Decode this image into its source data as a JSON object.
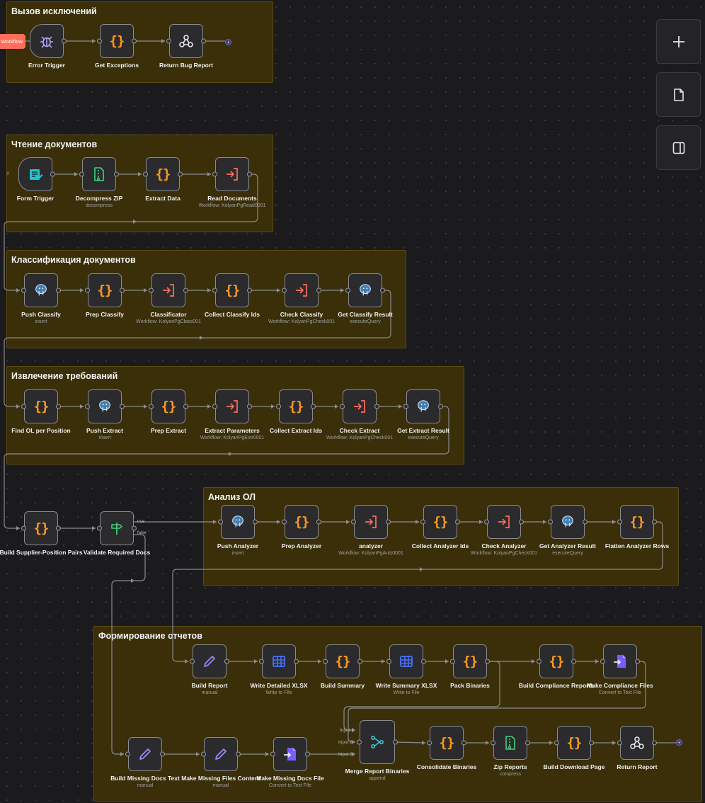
{
  "workflow_badge": "Workflow",
  "side_buttons": [
    {
      "name": "add-node-button",
      "icon": "plus-icon"
    },
    {
      "name": "sticky-note-button",
      "icon": "note-icon"
    },
    {
      "name": "toggle-panel-button",
      "icon": "panel-icon"
    }
  ],
  "groups": [
    {
      "id": "g1",
      "title": "Вызов исключений"
    },
    {
      "id": "g2",
      "title": "Чтение документов"
    },
    {
      "id": "g3",
      "title": "Классификация документов"
    },
    {
      "id": "g4",
      "title": "Извлечение требований"
    },
    {
      "id": "g5",
      "title": "Анализ ОЛ"
    },
    {
      "id": "g6",
      "title": "Формирование отчетов"
    }
  ],
  "nodes": [
    {
      "id": "n1",
      "label": "Error Trigger",
      "sub": "",
      "icon": "bug-icon"
    },
    {
      "id": "n2",
      "label": "Get Exceptions",
      "sub": "",
      "icon": "code-icon"
    },
    {
      "id": "n3",
      "label": "Return Bug Report",
      "sub": "",
      "icon": "webhook-icon"
    },
    {
      "id": "n4",
      "label": "Form Trigger",
      "sub": "",
      "icon": "form-icon"
    },
    {
      "id": "n5",
      "label": "Decompress ZIP",
      "sub": "decompress",
      "icon": "zip-file-icon"
    },
    {
      "id": "n6",
      "label": "Extract Data",
      "sub": "",
      "icon": "code-icon"
    },
    {
      "id": "n7",
      "label": "Read Documents",
      "sub": "Workflow: KolyanPgRead0001",
      "icon": "execute-workflow-icon"
    },
    {
      "id": "n8",
      "label": "Push Classify",
      "sub": "insert",
      "icon": "postgres-icon"
    },
    {
      "id": "n9",
      "label": "Prep Classify",
      "sub": "",
      "icon": "code-icon"
    },
    {
      "id": "n10",
      "label": "Classificator",
      "sub": "Workflow: KolyanPgClass001",
      "icon": "execute-workflow-icon"
    },
    {
      "id": "n11",
      "label": "Collect Classify Ids",
      "sub": "",
      "icon": "code-icon"
    },
    {
      "id": "n12",
      "label": "Check Classify",
      "sub": "Workflow: KolyanPgCheck001",
      "icon": "execute-workflow-icon"
    },
    {
      "id": "n13",
      "label": "Get Classify Result",
      "sub": "executeQuery",
      "icon": "postgres-icon"
    },
    {
      "id": "n14",
      "label": "Find OL per Position",
      "sub": "",
      "icon": "code-icon"
    },
    {
      "id": "n15",
      "label": "Push Extract",
      "sub": "insert",
      "icon": "postgres-icon"
    },
    {
      "id": "n16",
      "label": "Prep Extract",
      "sub": "",
      "icon": "code-icon"
    },
    {
      "id": "n17",
      "label": "Extract Parameters",
      "sub": "Workflow: KolyanPgExtr0001",
      "icon": "execute-workflow-icon"
    },
    {
      "id": "n18",
      "label": "Collect Extract Ids",
      "sub": "",
      "icon": "code-icon"
    },
    {
      "id": "n19",
      "label": "Check Extract",
      "sub": "Workflow: KolyanPgCheck001",
      "icon": "execute-workflow-icon"
    },
    {
      "id": "n20",
      "label": "Get Extract Result",
      "sub": "executeQuery",
      "icon": "postgres-icon"
    },
    {
      "id": "n21",
      "label": "Build Supplier-Position Pairs",
      "sub": "",
      "icon": "code-icon"
    },
    {
      "id": "n22",
      "label": "Validate Required Docs",
      "sub": "",
      "icon": "if-signpost-icon"
    },
    {
      "id": "n23",
      "label": "Push Analyzer",
      "sub": "insert",
      "icon": "postgres-icon"
    },
    {
      "id": "n24",
      "label": "Prep Analyzer",
      "sub": "",
      "icon": "code-icon"
    },
    {
      "id": "n25",
      "label": "analyzer",
      "sub": "Workflow: KolyanPgAnlz0001",
      "icon": "execute-workflow-icon"
    },
    {
      "id": "n26",
      "label": "Collect Analyzer Ids",
      "sub": "",
      "icon": "code-icon"
    },
    {
      "id": "n27",
      "label": "Check Analyzer",
      "sub": "Workflow: KolyanPgCheck001",
      "icon": "execute-workflow-icon"
    },
    {
      "id": "n28",
      "label": "Get Analyzer Result",
      "sub": "executeQuery",
      "icon": "postgres-icon"
    },
    {
      "id": "n29",
      "label": "Flatten Analyzer Rows",
      "sub": "",
      "icon": "code-icon"
    },
    {
      "id": "n30",
      "label": "Build Report",
      "sub": "manual",
      "icon": "pencil-icon"
    },
    {
      "id": "n31",
      "label": "Write Detailed XLSX",
      "sub": "Write to File",
      "icon": "spreadsheet-icon"
    },
    {
      "id": "n32",
      "label": "Build Summary",
      "sub": "",
      "icon": "code-icon"
    },
    {
      "id": "n33",
      "label": "Write Summary XLSX",
      "sub": "Write to File",
      "icon": "spreadsheet-icon"
    },
    {
      "id": "n34",
      "label": "Pack Binaries",
      "sub": "",
      "icon": "code-icon"
    },
    {
      "id": "n35",
      "label": "Build Compliance Reports",
      "sub": "",
      "icon": "code-icon"
    },
    {
      "id": "n36",
      "label": "Make Compliance Files",
      "sub": "Convert to Text File",
      "icon": "convert-file-icon"
    },
    {
      "id": "n37",
      "label": "Build Missing Docs Text",
      "sub": "manual",
      "icon": "pencil-icon"
    },
    {
      "id": "n38",
      "label": "Make Missing Files Content",
      "sub": "manual",
      "icon": "pencil-icon"
    },
    {
      "id": "n39",
      "label": "Make Missing Docs File",
      "sub": "Convert to Text File",
      "icon": "convert-file-icon"
    },
    {
      "id": "n40",
      "label": "Merge Report Binaries",
      "sub": "append",
      "icon": "merge-icon"
    },
    {
      "id": "n41",
      "label": "Consolidate Binaries",
      "sub": "",
      "icon": "code-icon"
    },
    {
      "id": "n42",
      "label": "Zip Reports",
      "sub": "compress",
      "icon": "zip-file-icon"
    },
    {
      "id": "n43",
      "label": "Build Download Page",
      "sub": "",
      "icon": "code-icon"
    },
    {
      "id": "n44",
      "label": "Return Report",
      "sub": "",
      "icon": "webhook-icon"
    }
  ],
  "branch_labels": {
    "true": "true",
    "false": "false"
  },
  "merge_inputs": [
    "Input 1",
    "Input 2",
    "Input 3"
  ]
}
